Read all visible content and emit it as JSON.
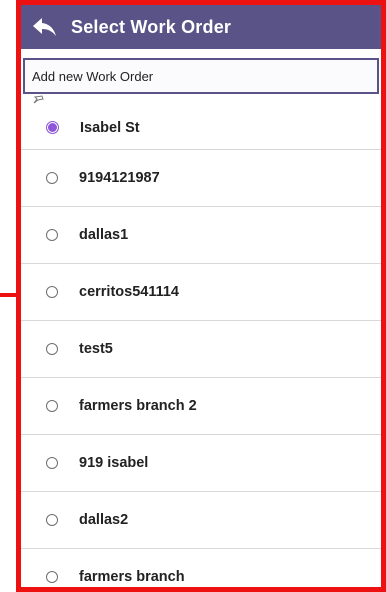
{
  "header": {
    "title": "Select Work Order",
    "back_icon": "back-arrow-icon"
  },
  "add_new": {
    "label": "Add new Work Order"
  },
  "work_orders": [
    {
      "label": "Isabel St",
      "selected": true
    },
    {
      "label": "9194121987",
      "selected": false
    },
    {
      "label": "dallas1",
      "selected": false
    },
    {
      "label": "cerritos541114",
      "selected": false
    },
    {
      "label": "test5",
      "selected": false
    },
    {
      "label": "farmers branch 2",
      "selected": false
    },
    {
      "label": "919 isabel",
      "selected": false
    },
    {
      "label": "dallas2",
      "selected": false
    },
    {
      "label": "farmers branch",
      "selected": false
    }
  ],
  "colors": {
    "titlebar": "#5a5387",
    "accent": "#8c57d9",
    "highlight_frame": "#ee1111"
  }
}
